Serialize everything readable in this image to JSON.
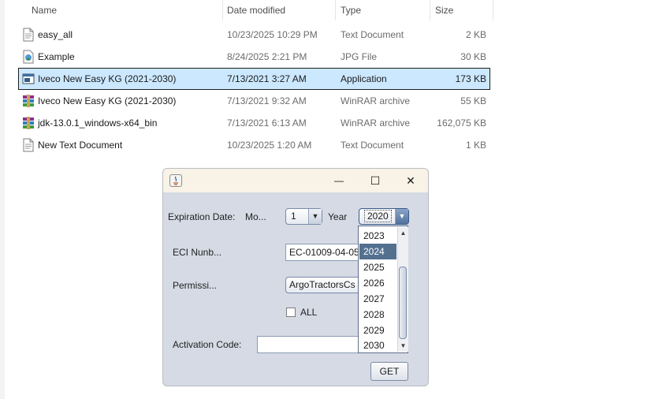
{
  "explorer": {
    "columns": {
      "name": "Name",
      "date": "Date modified",
      "type": "Type",
      "size": "Size"
    },
    "files": [
      {
        "name": "easy_all",
        "date": "10/23/2025 10:29 PM",
        "type": "Text Document",
        "size": "2 KB",
        "icon": "text-file-icon"
      },
      {
        "name": "Example",
        "date": "8/24/2025 2:21 PM",
        "type": "JPG File",
        "size": "30 KB",
        "icon": "image-file-icon"
      },
      {
        "name": "Iveco New Easy KG (2021-2030)",
        "date": "7/13/2021 3:27 AM",
        "type": "Application",
        "size": "173 KB",
        "icon": "application-icon",
        "selected": true
      },
      {
        "name": "Iveco New Easy KG (2021-2030)",
        "date": "7/13/2021 9:32 AM",
        "type": "WinRAR archive",
        "size": "55 KB",
        "icon": "winrar-archive-icon"
      },
      {
        "name": "jdk-13.0.1_windows-x64_bin",
        "date": "7/13/2021 6:13 AM",
        "type": "WinRAR archive",
        "size": "162,075 KB",
        "icon": "winrar-archive-icon"
      },
      {
        "name": "New Text Document",
        "date": "10/23/2025 1:20 AM",
        "type": "Text Document",
        "size": "1 KB",
        "icon": "text-file-icon"
      }
    ]
  },
  "dialog": {
    "window_buttons": {
      "minimize": "—",
      "maximize": "☐",
      "close": "✕"
    },
    "expiration_label": "Expiration Date:",
    "month_label": "Mo...",
    "month_value": "1",
    "year_label": "Year",
    "year_value": "2020",
    "eci_label": "ECI Nunb...",
    "eci_value": "EC-01009-04-05",
    "permission_label": "Permissi...",
    "permission_value": "ArgoTractorsCs",
    "all_label": "ALL",
    "activation_label": "Activation Code:",
    "activation_value": "",
    "get_button": "GET",
    "year_options": [
      "2023",
      "2024",
      "2025",
      "2026",
      "2027",
      "2028",
      "2029",
      "2030"
    ],
    "selected_year_option": "2024"
  }
}
